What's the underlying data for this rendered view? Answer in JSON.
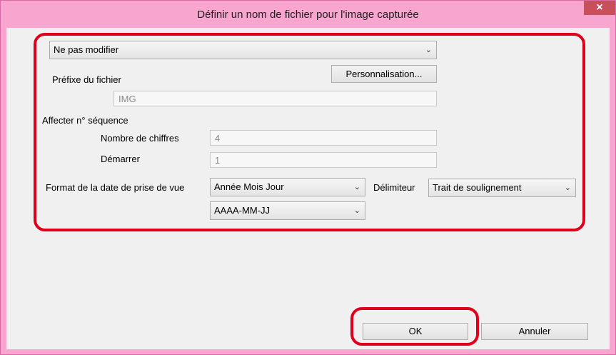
{
  "window": {
    "title": "Définir un nom de fichier pour l'image capturée",
    "close_glyph": "×"
  },
  "preset": {
    "selected": "Ne pas modifier"
  },
  "prefix": {
    "label": "Préfixe du fichier",
    "customize_label": "Personnalisation...",
    "value": "IMG"
  },
  "sequence": {
    "label": "Affecter n° séquence",
    "digits_label": "Nombre de chiffres",
    "digits_value": "4",
    "start_label": "Démarrer",
    "start_value": "1"
  },
  "date": {
    "label": "Format de la date de prise de vue",
    "order_selected": "Année Mois Jour",
    "delimiter_label": "Délimiteur",
    "delimiter_selected": "Trait de soulignement",
    "format_selected": "AAAA-MM-JJ"
  },
  "footer": {
    "ok_label": "OK",
    "cancel_label": "Annuler"
  },
  "icons": {
    "dropdown": "chevron-down-icon",
    "close": "close-icon"
  },
  "colors": {
    "highlight": "#e0001b",
    "titlebar": "#f8a6cf",
    "close_button": "#c7505c"
  }
}
